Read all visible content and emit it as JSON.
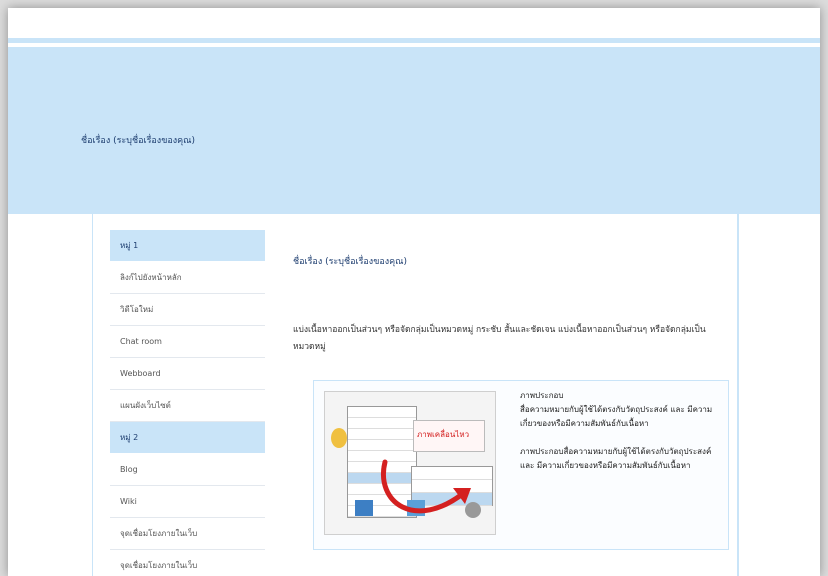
{
  "header": {
    "site_title": "ชื่อเรื่อง (ระบุชื่อเรื่องของคุณ)"
  },
  "sidebar": {
    "groups": [
      {
        "heading": "หมู่ 1",
        "items": [
          "ลิงก์ไปยังหน้าหลัก",
          "วิดีโอใหม่",
          "Chat room",
          "Webboard",
          "แผนผังเว็บไซต์"
        ]
      },
      {
        "heading": "หมู่ 2",
        "items": [
          "Blog",
          "Wiki",
          "จุดเชื่อมโยงภายในเว็บ",
          "จุดเชื่อมโยงภายในเว็บ"
        ]
      }
    ]
  },
  "content": {
    "title": "ชื่อเรื่อง (ระบุชื่อเรื่องของคุณ)",
    "description": "แบ่งเนื้อหาออกเป็นส่วนๆ หรือจัดกลุ่มเป็นหมวดหมู่ กระชับ สั้นและชัดเจน แบ่งเนื้อหาออกเป็นส่วนๆ หรือจัดกลุ่มเป็นหมวดหมู่",
    "figure": {
      "image_caption": "ภาพเคลื่อนไหว",
      "text_blocks": [
        {
          "heading": "ภาพประกอบ",
          "body": "สื่อความหมายกับผู้ใช้ได้ตรงกับวัตถุประสงค์ และ มีความเกี่ยวของหรือมีความสัมพันธ์กับเนื้อหา"
        },
        {
          "heading": "",
          "body": "ภาพประกอบสื่อความหมายกับผู้ใช้ได้ตรงกับวัตถุประสงค์ และ มีความเกี่ยวของหรือมีความสัมพันธ์กับเนื้อหา"
        }
      ]
    }
  },
  "colors": {
    "header_bg": "#c9e4f8",
    "title_text": "#1c3c6e",
    "arrow": "#d42020"
  }
}
